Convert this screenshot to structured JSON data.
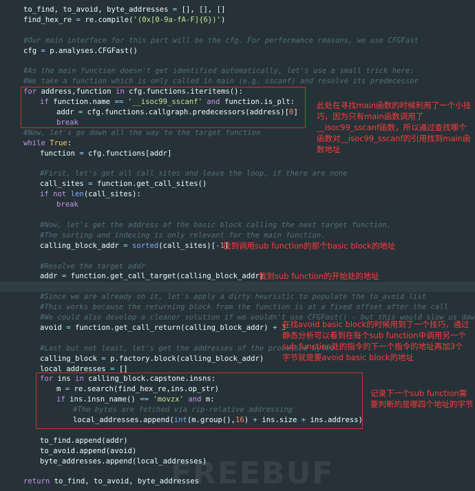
{
  "colors": {
    "background": "#263238",
    "annotation": "#ff3b3b",
    "box": "#d32f2f"
  },
  "code_lines": [
    {
      "indent": 0,
      "tokens": [
        [
          "v",
          "to_find, to_avoid, byte_addresses "
        ],
        [
          "o",
          "="
        ],
        [
          "v",
          " [], [], []"
        ]
      ]
    },
    {
      "indent": 0,
      "tokens": [
        [
          "v",
          "find_hex_re "
        ],
        [
          "o",
          "="
        ],
        [
          "v",
          " re.compile("
        ],
        [
          "s",
          "'(0x[0-9a-fA-F]{6})'"
        ],
        [
          "v",
          ")"
        ]
      ]
    },
    {
      "indent": 0,
      "tokens": []
    },
    {
      "indent": 0,
      "tokens": [
        [
          "c",
          "#Our main interface for this part will be the cfg. For performance reasons, we use CFGFast"
        ]
      ]
    },
    {
      "indent": 0,
      "tokens": [
        [
          "v",
          "cfg "
        ],
        [
          "o",
          "="
        ],
        [
          "v",
          " p.analyses.CFGFast()"
        ]
      ]
    },
    {
      "indent": 0,
      "tokens": []
    },
    {
      "indent": 0,
      "tokens": [
        [
          "c",
          "#As the main function doesn't get identified automatically, let's use a small trick here:"
        ]
      ]
    },
    {
      "indent": 0,
      "tokens": [
        [
          "c",
          "#We take a function which is only called in main (e.g. sscanf) and resolve its predecessor"
        ]
      ]
    },
    {
      "indent": 0,
      "tokens": [
        [
          "k",
          "for"
        ],
        [
          "v",
          " address,function "
        ],
        [
          "k",
          "in"
        ],
        [
          "v",
          " cfg.functions.iteritems():"
        ]
      ]
    },
    {
      "indent": 1,
      "tokens": [
        [
          "k",
          "if"
        ],
        [
          "v",
          " function.name "
        ],
        [
          "o",
          "=="
        ],
        [
          "v",
          " "
        ],
        [
          "s",
          "'__isoc99_sscanf'"
        ],
        [
          "v",
          " "
        ],
        [
          "k",
          "and"
        ],
        [
          "v",
          " function.is_plt:"
        ]
      ]
    },
    {
      "indent": 2,
      "tokens": [
        [
          "v",
          "addr "
        ],
        [
          "o",
          "="
        ],
        [
          "v",
          " cfg.functions.callgraph.predecessors(address)["
        ],
        [
          "n",
          "0"
        ],
        [
          "v",
          "]"
        ]
      ]
    },
    {
      "indent": 2,
      "tokens": [
        [
          "k",
          "break"
        ]
      ]
    },
    {
      "indent": 0,
      "tokens": [
        [
          "c",
          "#Now, let's go down all the way to the target function"
        ]
      ]
    },
    {
      "indent": 0,
      "tokens": [
        [
          "k",
          "while"
        ],
        [
          "v",
          " "
        ],
        [
          "b",
          "True"
        ],
        [
          "v",
          ":"
        ]
      ]
    },
    {
      "indent": 1,
      "tokens": [
        [
          "v",
          "function "
        ],
        [
          "o",
          "="
        ],
        [
          "v",
          " cfg.functions[addr]"
        ]
      ]
    },
    {
      "indent": 0,
      "tokens": []
    },
    {
      "indent": 1,
      "tokens": [
        [
          "c",
          "#First, let's get all call_sites and leave the loop, if there are none"
        ]
      ]
    },
    {
      "indent": 1,
      "tokens": [
        [
          "v",
          "call_sites "
        ],
        [
          "o",
          "="
        ],
        [
          "v",
          " function.get_call_sites()"
        ]
      ]
    },
    {
      "indent": 1,
      "tokens": [
        [
          "k",
          "if not"
        ],
        [
          "v",
          " "
        ],
        [
          "f",
          "len"
        ],
        [
          "v",
          "(call_sites):"
        ]
      ]
    },
    {
      "indent": 2,
      "tokens": [
        [
          "k",
          "break"
        ]
      ]
    },
    {
      "indent": 0,
      "tokens": []
    },
    {
      "indent": 1,
      "tokens": [
        [
          "c",
          "#Now, let's get the address of the basic block calling the next target function."
        ]
      ]
    },
    {
      "indent": 1,
      "tokens": [
        [
          "c",
          "#The sorting and indexing is only relevant for the main function."
        ]
      ]
    },
    {
      "indent": 1,
      "tokens": [
        [
          "v",
          "calling_block_addr "
        ],
        [
          "o",
          "="
        ],
        [
          "v",
          " "
        ],
        [
          "f",
          "sorted"
        ],
        [
          "v",
          "(call_sites)["
        ],
        [
          "o",
          "-"
        ],
        [
          "n",
          "1"
        ],
        [
          "v",
          "]"
        ]
      ]
    },
    {
      "indent": 0,
      "tokens": []
    },
    {
      "indent": 1,
      "tokens": [
        [
          "c",
          "#Resolve the target addr"
        ]
      ]
    },
    {
      "indent": 1,
      "tokens": [
        [
          "v",
          "addr "
        ],
        [
          "o",
          "="
        ],
        [
          "v",
          " function.get_call_target(calling_block_addr)"
        ]
      ]
    },
    {
      "indent": 0,
      "tokens": [],
      "highlight": true
    },
    {
      "indent": 1,
      "tokens": [
        [
          "c",
          "#Since we are already on it, let's apply a dirty heuristic to populate the to_avoid list"
        ]
      ]
    },
    {
      "indent": 1,
      "tokens": [
        [
          "c",
          "#This works because the returning block from the function is at a fixed offset after the call"
        ]
      ]
    },
    {
      "indent": 1,
      "tokens": [
        [
          "c",
          "#We could also develop a cleaner solution if we wouldn't use CFGFast() - but this would slow us down"
        ]
      ]
    },
    {
      "indent": 1,
      "tokens": [
        [
          "v",
          "avoid "
        ],
        [
          "o",
          "="
        ],
        [
          "v",
          " function.get_call_return(calling_block_addr) "
        ],
        [
          "o",
          "+"
        ],
        [
          "v",
          " "
        ],
        [
          "n",
          "3"
        ]
      ]
    },
    {
      "indent": 0,
      "tokens": []
    },
    {
      "indent": 1,
      "tokens": [
        [
          "c",
          "#Last but not least, let's get the addresses of the processed bytes"
        ]
      ]
    },
    {
      "indent": 1,
      "tokens": [
        [
          "v",
          "calling_block "
        ],
        [
          "o",
          "="
        ],
        [
          "v",
          " p.factory.block(calling_block_addr)"
        ]
      ]
    },
    {
      "indent": 1,
      "tokens": [
        [
          "v",
          "local_addresses "
        ],
        [
          "o",
          "="
        ],
        [
          "v",
          " []"
        ]
      ]
    },
    {
      "indent": 1,
      "tokens": [
        [
          "k",
          "for"
        ],
        [
          "v",
          " ins "
        ],
        [
          "k",
          "in"
        ],
        [
          "v",
          " calling_block.capstone.insns:"
        ]
      ]
    },
    {
      "indent": 2,
      "tokens": [
        [
          "v",
          "m "
        ],
        [
          "o",
          "="
        ],
        [
          "v",
          " re.search(find_hex_re,ins.op_str)"
        ]
      ]
    },
    {
      "indent": 2,
      "tokens": [
        [
          "k",
          "if"
        ],
        [
          "v",
          " ins.insn_name() "
        ],
        [
          "o",
          "=="
        ],
        [
          "v",
          " "
        ],
        [
          "s",
          "'movzx'"
        ],
        [
          "v",
          " "
        ],
        [
          "k",
          "and"
        ],
        [
          "v",
          " m:"
        ]
      ]
    },
    {
      "indent": 3,
      "tokens": [
        [
          "c",
          "#The bytes are fetched via rip-relative addressing"
        ]
      ]
    },
    {
      "indent": 3,
      "tokens": [
        [
          "v",
          "local_addresses.append("
        ],
        [
          "f",
          "int"
        ],
        [
          "v",
          "(m.group(),"
        ],
        [
          "n",
          "16"
        ],
        [
          "v",
          ") "
        ],
        [
          "o",
          "+"
        ],
        [
          "v",
          " ins.size "
        ],
        [
          "o",
          "+"
        ],
        [
          "v",
          " ins.address)"
        ]
      ]
    },
    {
      "indent": 0,
      "tokens": []
    },
    {
      "indent": 1,
      "tokens": [
        [
          "v",
          "to_find.append(addr)"
        ]
      ]
    },
    {
      "indent": 1,
      "tokens": [
        [
          "v",
          "to_avoid.append(avoid)"
        ]
      ]
    },
    {
      "indent": 1,
      "tokens": [
        [
          "v",
          "byte_addresses.append(local_addresses)"
        ]
      ]
    },
    {
      "indent": 0,
      "tokens": []
    },
    {
      "indent": 0,
      "tokens": [
        [
          "k",
          "return"
        ],
        [
          "v",
          " to_find, to_avoid, byte_addresses"
        ]
      ]
    }
  ],
  "annotations": {
    "main_trick": "此处在寻找main函数的时候利用了一个小技巧，因为只有main函数调用了__isoc99_sscanf函数，所以通过查找哪个函数对__isoc99_sscanf的引用找到main函数地址",
    "basic_block": "找到调用sub function的那个basic block的地址",
    "sub_function_start": "找到sub function的开始处的地址",
    "avoid_trick": "在找avoid basic block的时候用到了一个技巧，通过静态分析可以看到在每个sub function中调用另一个sub function处的指令的下一个指令的地址再加3个字节就是要avoid basic block的地址",
    "byte_offsets": "记录下一个sub function需要判断的是哪四个地址的字节"
  },
  "watermark": "FREEBUF"
}
